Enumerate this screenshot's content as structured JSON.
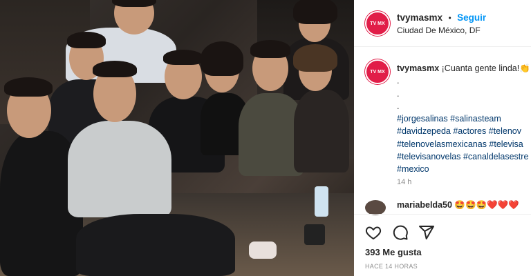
{
  "post": {
    "username": "tvymasmx",
    "separator": "•",
    "follow_label": "Seguir",
    "location": "Ciudad De México, DF",
    "avatar_text": "TV MX",
    "caption_text": "¡Cuanta gente linda!👏",
    "caption_dots": [
      ".",
      ".",
      "."
    ],
    "hashtag_lines": [
      "#jorgesalinas #salinasteam",
      "#davidzepeda #actores #telenov",
      "#telenovelasmexicanas #televisa",
      "#televisanovelas #canaldelasestre",
      "#mexico"
    ],
    "caption_time": "14 h"
  },
  "comment": {
    "username": "mariabelda50",
    "emojis": "🤩🤩🤩❤️❤️❤️"
  },
  "actions": {
    "like_icon": "heart-icon",
    "comment_icon": "comment-icon",
    "share_icon": "share-icon",
    "likes_text": "393 Me gusta",
    "timestamp": "HACE 14 HORAS"
  }
}
